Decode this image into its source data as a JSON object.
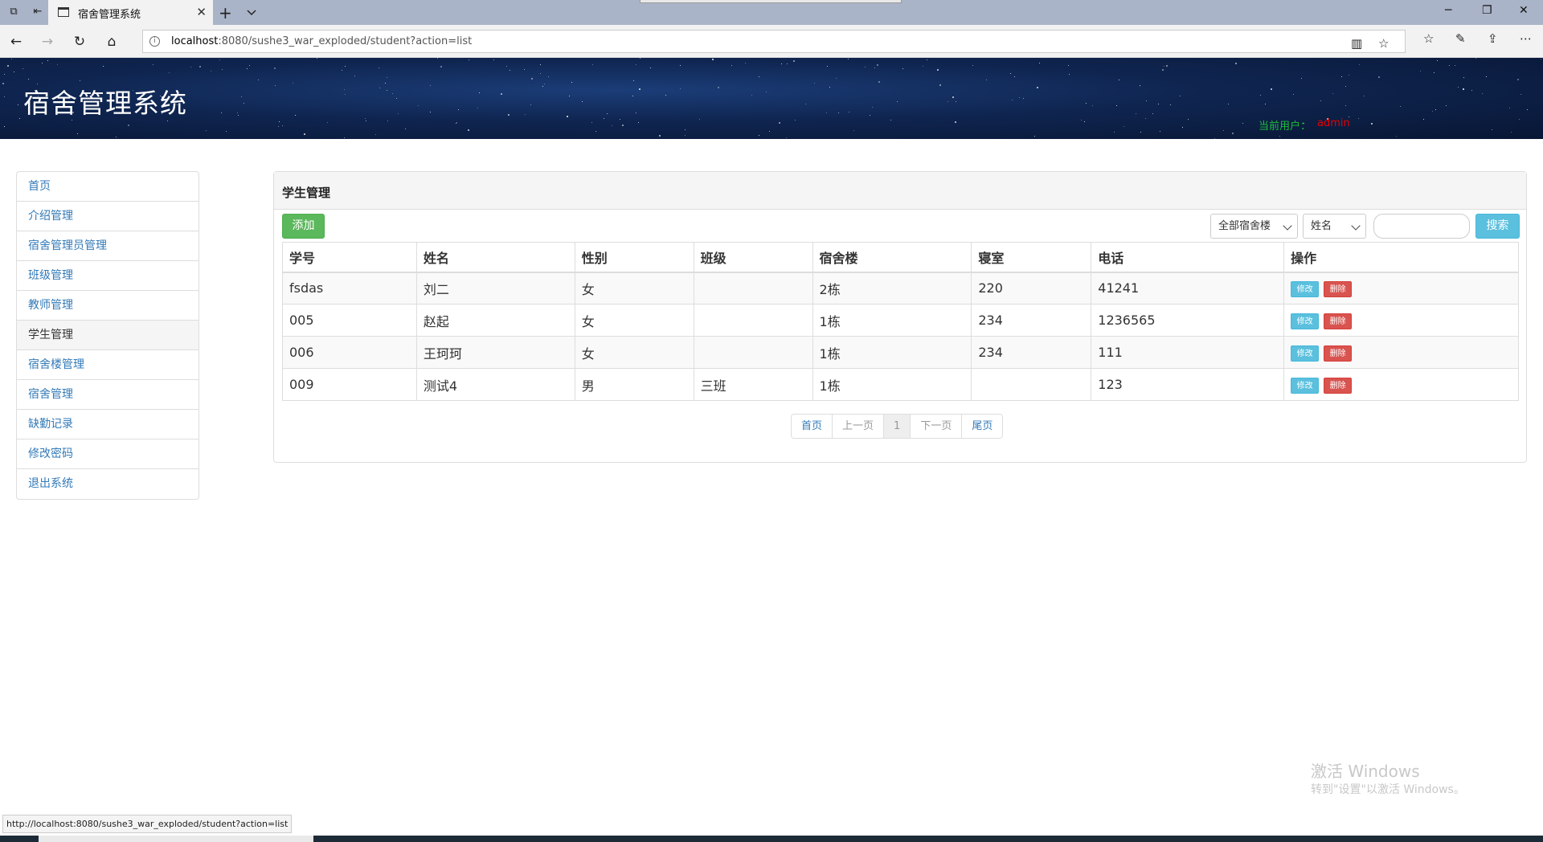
{
  "browser": {
    "tab_title": "宿舍管理系统",
    "url_host": "localhost",
    "url_rest": ":8080/sushe3_war_exploded/student?action=list",
    "status_url": "http://localhost:8080/sushe3_war_exploded/student?action=list"
  },
  "header": {
    "site_title": "宿舍管理系统",
    "current_user_label": "当前用户：",
    "current_user": "admin"
  },
  "sidebar": {
    "items": [
      {
        "label": "首页"
      },
      {
        "label": "介绍管理"
      },
      {
        "label": "宿舍管理员管理"
      },
      {
        "label": "班级管理"
      },
      {
        "label": "教师管理"
      },
      {
        "label": "学生管理"
      },
      {
        "label": "宿舍楼管理"
      },
      {
        "label": "宿舍管理"
      },
      {
        "label": "缺勤记录"
      },
      {
        "label": "修改密码"
      },
      {
        "label": "退出系统"
      }
    ],
    "active_index": 5
  },
  "panel": {
    "title": "学生管理",
    "add_button": "添加",
    "building_filter": "全部宿舍楼",
    "field_filter": "姓名",
    "search_value": "",
    "search_button": "搜索"
  },
  "table": {
    "headers": [
      "学号",
      "姓名",
      "性别",
      "班级",
      "宿舍楼",
      "寝室",
      "电话",
      "操作"
    ],
    "rows": [
      {
        "id": "fsdas",
        "name": "刘二",
        "gender": "女",
        "class": "",
        "building": "2栋",
        "room": "220",
        "phone": "41241"
      },
      {
        "id": "005",
        "name": "赵起",
        "gender": "女",
        "class": "",
        "building": "1栋",
        "room": "234",
        "phone": "1236565"
      },
      {
        "id": "006",
        "name": "王珂珂",
        "gender": "女",
        "class": "",
        "building": "1栋",
        "room": "234",
        "phone": "111"
      },
      {
        "id": "009",
        "name": "测试4",
        "gender": "男",
        "class": "三班",
        "building": "1栋",
        "room": "",
        "phone": "123"
      }
    ],
    "edit_label": "修改",
    "delete_label": "删除"
  },
  "pagination": {
    "first": "首页",
    "prev": "上一页",
    "current": "1",
    "next": "下一页",
    "last": "尾页"
  },
  "watermark": {
    "line1": "激活 Windows",
    "line2": "转到\"设置\"以激活 Windows。"
  }
}
